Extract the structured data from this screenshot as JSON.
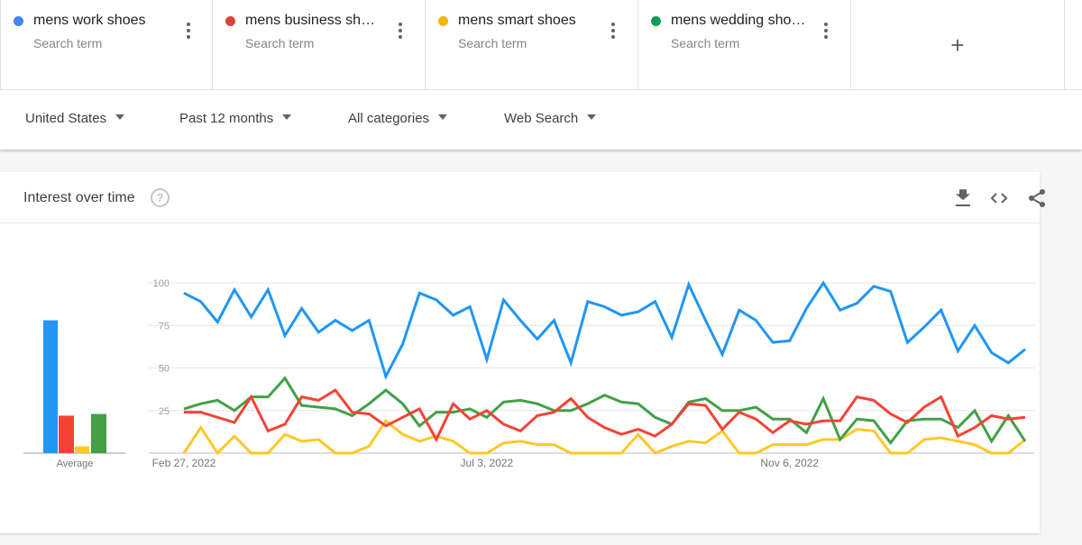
{
  "terms": [
    {
      "name": "mens work shoes",
      "sub": "Search term",
      "color": "#4285f4"
    },
    {
      "name": "mens business sh…",
      "sub": "Search term",
      "color": "#db4437"
    },
    {
      "name": "mens smart shoes",
      "sub": "Search term",
      "color": "#f4b400"
    },
    {
      "name": "mens wedding sho…",
      "sub": "Search term",
      "color": "#0f9d58"
    }
  ],
  "add_term_label": "+",
  "filters": {
    "region": "United States",
    "period": "Past 12 months",
    "category": "All categories",
    "search_type": "Web Search"
  },
  "card": {
    "title": "Interest over time",
    "help_label": "?"
  },
  "chart_data": {
    "type": "line",
    "title": "Interest over time",
    "ylim": [
      0,
      100
    ],
    "yticks": [
      25,
      50,
      75,
      100
    ],
    "xtick_labels": [
      {
        "index": 0,
        "label": "Feb 27, 2022"
      },
      {
        "index": 18,
        "label": "Jul 3, 2022"
      },
      {
        "index": 36,
        "label": "Nov 6, 2022"
      }
    ],
    "x_start": "Feb 27, 2022",
    "x_interval": "weekly",
    "grid": true,
    "series": [
      {
        "name": "mens work shoes",
        "color": "#2196f3",
        "average": 78,
        "values": [
          94,
          89,
          77,
          96,
          80,
          96,
          69,
          85,
          71,
          78,
          72,
          78,
          45,
          64,
          94,
          90,
          81,
          86,
          55,
          90,
          78,
          67,
          78,
          53,
          89,
          86,
          81,
          83,
          89,
          68,
          99,
          78,
          58,
          84,
          78,
          65,
          66,
          85,
          100,
          84,
          88,
          98,
          95,
          65,
          74,
          84,
          60,
          75,
          59,
          53,
          61
        ]
      },
      {
        "name": "mens business shoes",
        "color": "#f44336",
        "average": 22,
        "values": [
          24,
          24,
          21,
          18,
          33,
          13,
          17,
          33,
          31,
          37,
          24,
          23,
          16,
          21,
          26,
          8,
          29,
          20,
          25,
          17,
          13,
          22,
          24,
          32,
          21,
          15,
          11,
          14,
          10,
          17,
          29,
          28,
          14,
          24,
          20,
          12,
          19,
          17,
          19,
          19,
          33,
          31,
          23,
          18,
          27,
          33,
          10,
          15,
          22,
          20,
          21
        ]
      },
      {
        "name": "mens smart shoes",
        "color": "#ffc828",
        "average": 4,
        "values": [
          0,
          15,
          0,
          10,
          0,
          0,
          11,
          7,
          8,
          0,
          0,
          4,
          19,
          11,
          7,
          10,
          7,
          0,
          0,
          6,
          7,
          5,
          5,
          0,
          0,
          0,
          0,
          11,
          0,
          4,
          7,
          6,
          13,
          0,
          0,
          5,
          5,
          5,
          8,
          8,
          14,
          13,
          0,
          0,
          8,
          9,
          7,
          5,
          0,
          0,
          8
        ]
      },
      {
        "name": "mens wedding shoes",
        "color": "#43a047",
        "average": 23,
        "values": [
          26,
          29,
          31,
          25,
          33,
          33,
          44,
          28,
          27,
          26,
          22,
          29,
          37,
          29,
          16,
          24,
          24,
          26,
          21,
          30,
          31,
          29,
          25,
          25,
          29,
          34,
          30,
          29,
          21,
          17,
          30,
          32,
          25,
          25,
          27,
          20,
          20,
          12,
          32,
          8,
          20,
          19,
          6,
          19,
          20,
          20,
          15,
          25,
          7,
          22,
          7
        ]
      }
    ],
    "average_label": "Average"
  }
}
